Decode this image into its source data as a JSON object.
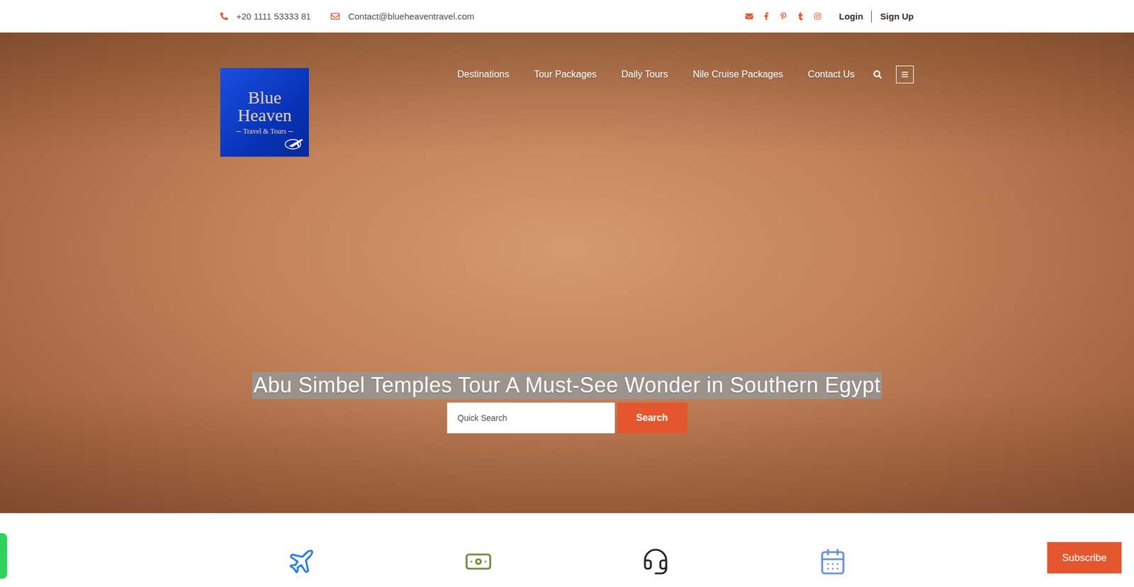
{
  "topbar": {
    "phone": "+20 1111 53333 81",
    "email": "Contact@blueheaventravel.com",
    "login": "Login",
    "signup": "Sign Up"
  },
  "logo": {
    "line1": "Blue",
    "line2": "Heaven",
    "tagline": "Travel & Tours"
  },
  "nav": {
    "items": [
      {
        "label": "Destinations"
      },
      {
        "label": "Tour Packages"
      },
      {
        "label": "Daily Tours"
      },
      {
        "label": "Nile Cruise Packages"
      },
      {
        "label": "Contact Us"
      }
    ]
  },
  "hero": {
    "title": "Abu Simbel Temples Tour A Must-See Wonder in Southern Egypt",
    "highlighted": true
  },
  "search": {
    "placeholder": "Quick Search",
    "button": "Search"
  },
  "subscribe": "Subscribe"
}
